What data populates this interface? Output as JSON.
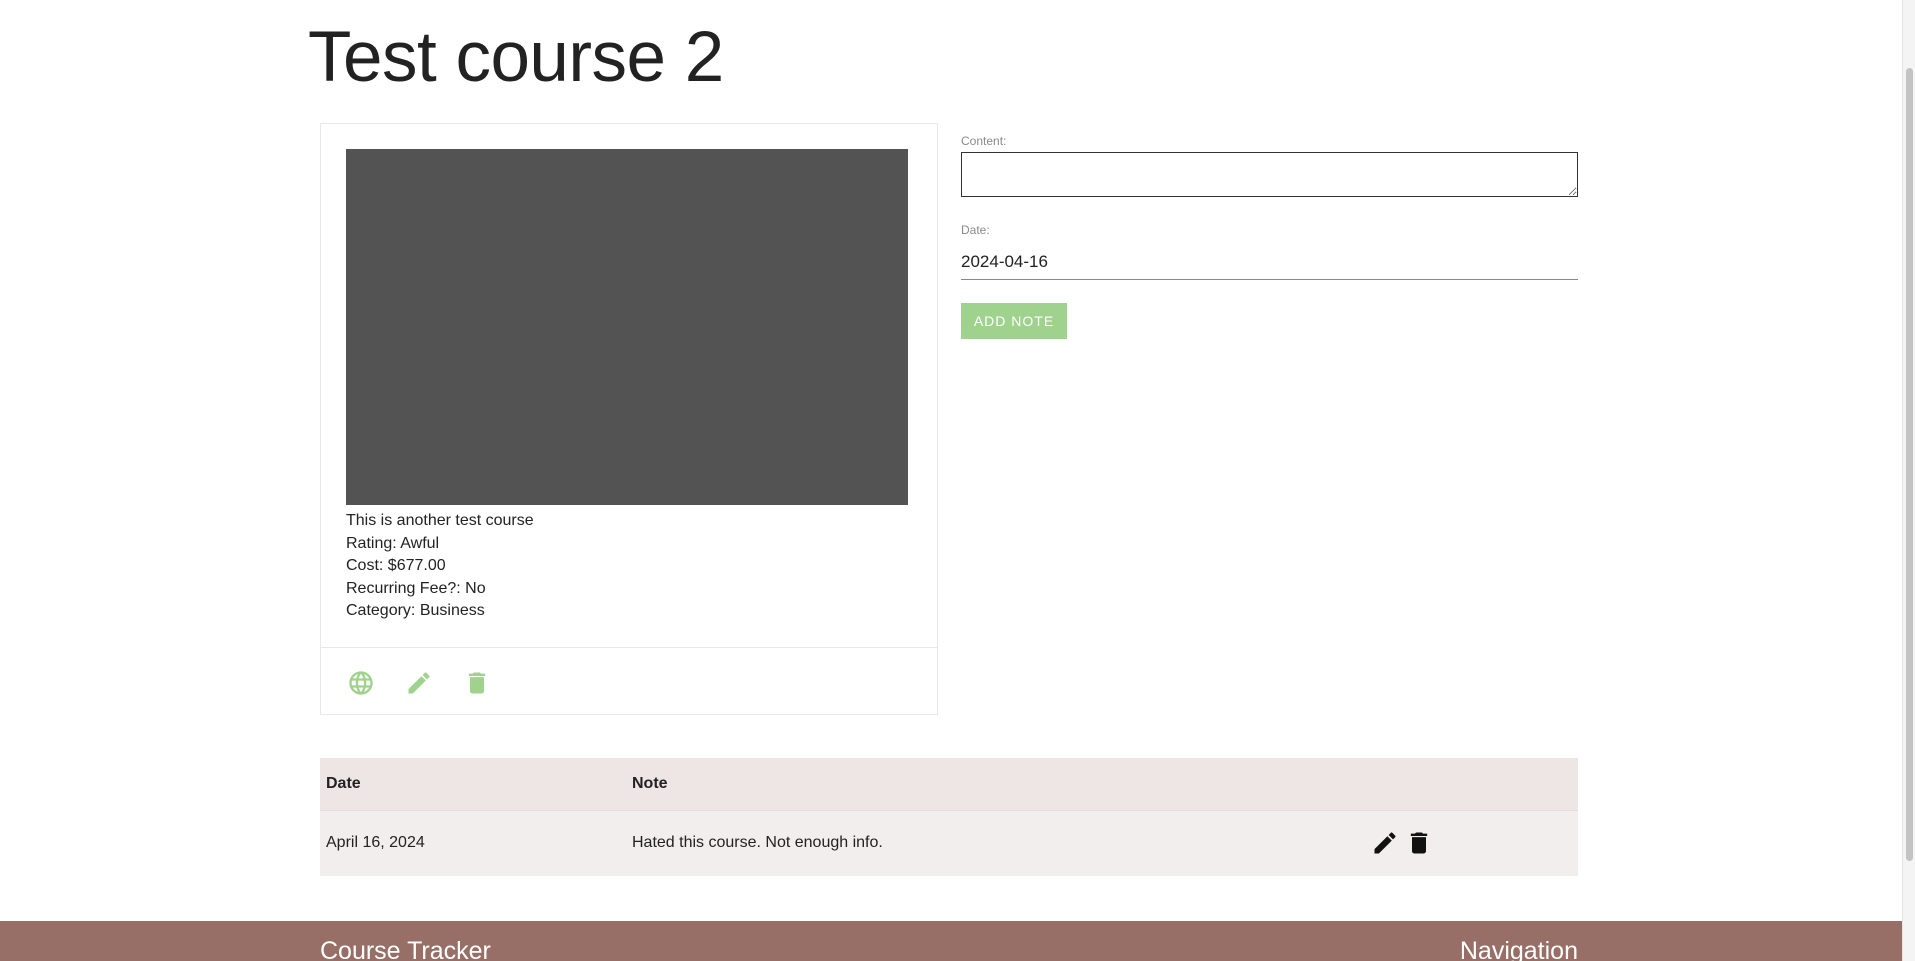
{
  "page": {
    "title": "Test course 2"
  },
  "course": {
    "description": "This is another test course",
    "rating": "Rating: Awful",
    "cost": "Cost: $677.00",
    "recurring_fee": "Recurring Fee?: No",
    "category": "Category: Business",
    "actions": [
      {
        "icon": "globe-icon",
        "color": "#9fd28d"
      },
      {
        "icon": "pencil-icon",
        "color": "#9fd28d"
      },
      {
        "icon": "trash-icon",
        "color": "#9fd28d"
      }
    ]
  },
  "note_form": {
    "content_label": "Content:",
    "content_value": "",
    "date_label": "Date:",
    "date_value": "2024-04-16",
    "add_button_label": "Add Note",
    "add_button_color": "#9fd28d"
  },
  "notes_table": {
    "headers": [
      "Date",
      "Note",
      ""
    ],
    "rows": [
      {
        "date": "April 16, 2024",
        "note": "Hated this course. Not enough info.",
        "actions": [
          "pencil-icon",
          "trash-icon"
        ]
      }
    ]
  },
  "footer": {
    "brand": "Course Tracker",
    "nav_title": "Navigation",
    "background": "#976f66"
  }
}
